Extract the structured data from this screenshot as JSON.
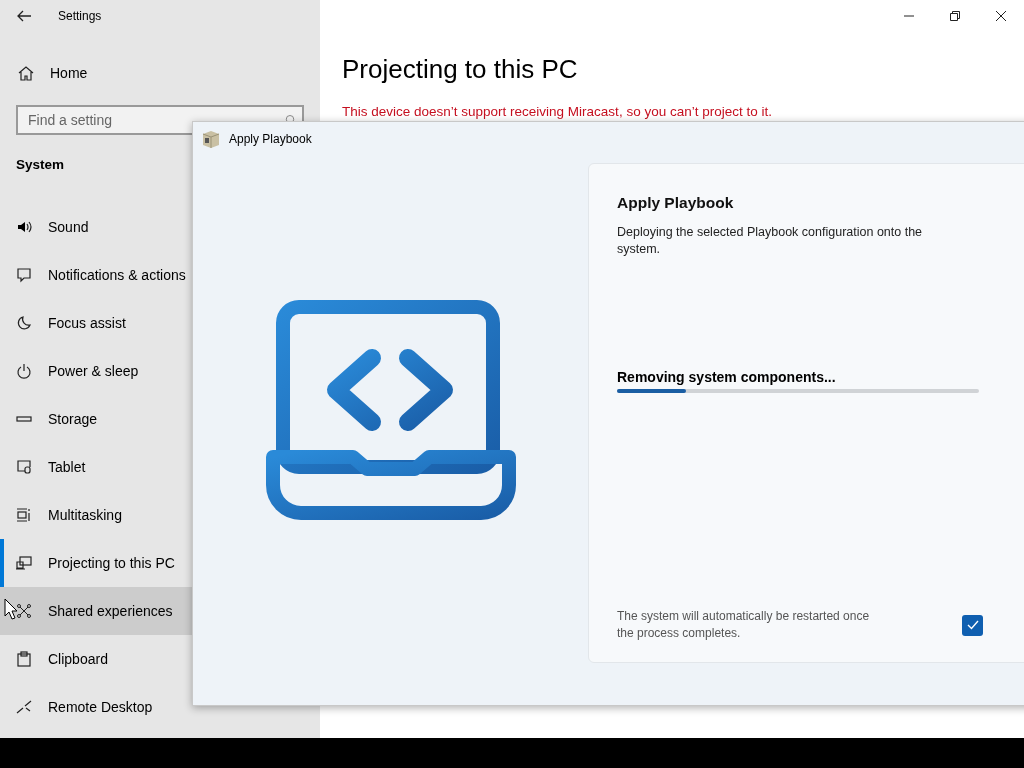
{
  "settings_window": {
    "title": "Settings",
    "home": "Home",
    "search": {
      "placeholder": "Find a setting"
    },
    "section": "System",
    "sidebar": {
      "items": [
        {
          "label": "Sound",
          "selected": false,
          "hovered": false
        },
        {
          "label": "Notifications & actions",
          "selected": false,
          "hovered": false
        },
        {
          "label": "Focus assist",
          "selected": false,
          "hovered": false
        },
        {
          "label": "Power & sleep",
          "selected": false,
          "hovered": false
        },
        {
          "label": "Storage",
          "selected": false,
          "hovered": false
        },
        {
          "label": "Tablet",
          "selected": false,
          "hovered": false
        },
        {
          "label": "Multitasking",
          "selected": false,
          "hovered": false
        },
        {
          "label": "Projecting to this PC",
          "selected": true,
          "hovered": false
        },
        {
          "label": "Shared experiences",
          "selected": false,
          "hovered": true
        },
        {
          "label": "Clipboard",
          "selected": false,
          "hovered": false
        },
        {
          "label": "Remote Desktop",
          "selected": false,
          "hovered": false
        }
      ]
    },
    "page_title": "Projecting to this PC",
    "warning": "This device doesn’t support receiving Miracast, so you can’t project to it."
  },
  "dialog": {
    "title": "Apply Playbook",
    "heading": "Apply Playbook",
    "description": "Deploying the selected Playbook configuration onto the system.",
    "status": "Removing system components...",
    "progress": {
      "level": 0.19
    },
    "restart_note": "The system will automatically be restarted once the process completes.",
    "restart_checked": true
  }
}
